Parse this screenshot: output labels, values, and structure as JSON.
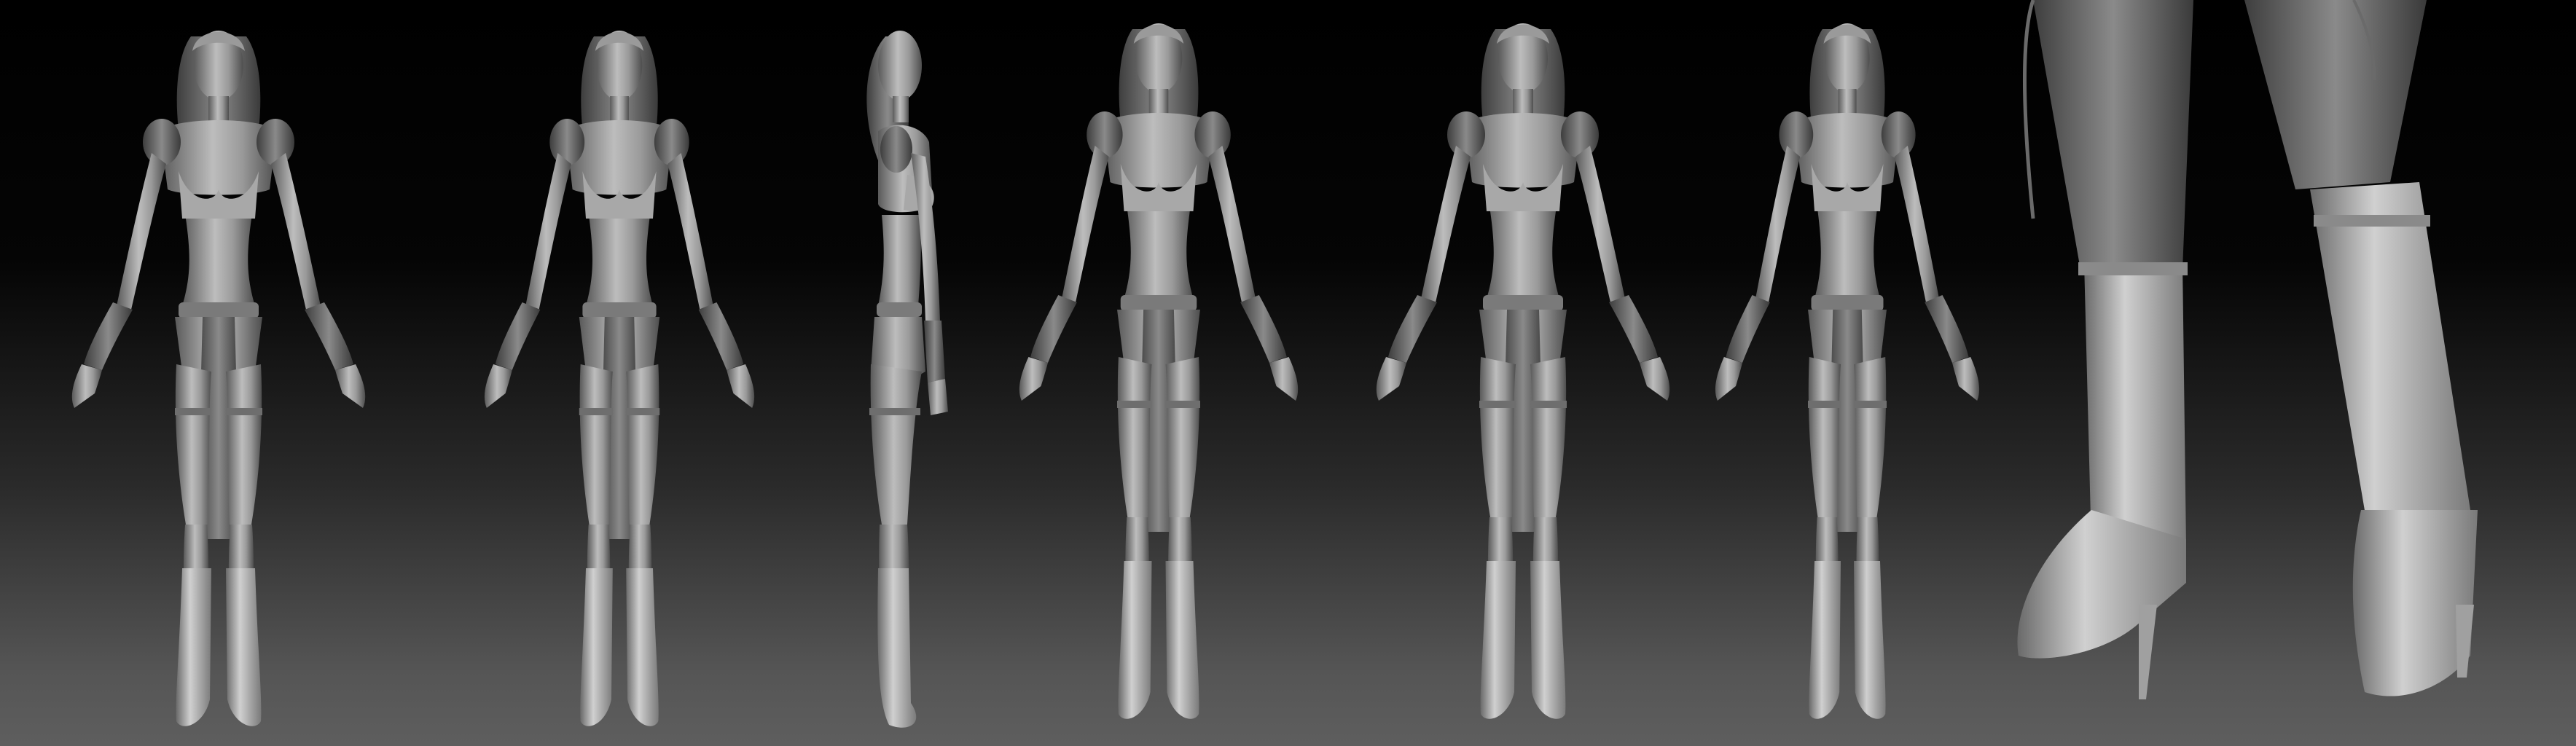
{
  "scene": {
    "background_top": "#000000",
    "background_bottom": "#5e5e5e",
    "clay_light": "#c9c9c9",
    "clay_mid": "#8e8e8e",
    "clay_dark": "#4a4a4a"
  },
  "views": [
    {
      "name": "front-view"
    },
    {
      "name": "front-three-quarter-view"
    },
    {
      "name": "side-view"
    },
    {
      "name": "back-three-quarter-view-left"
    },
    {
      "name": "back-view"
    },
    {
      "name": "back-three-quarter-view-right"
    },
    {
      "name": "boot-closeup-view"
    }
  ]
}
